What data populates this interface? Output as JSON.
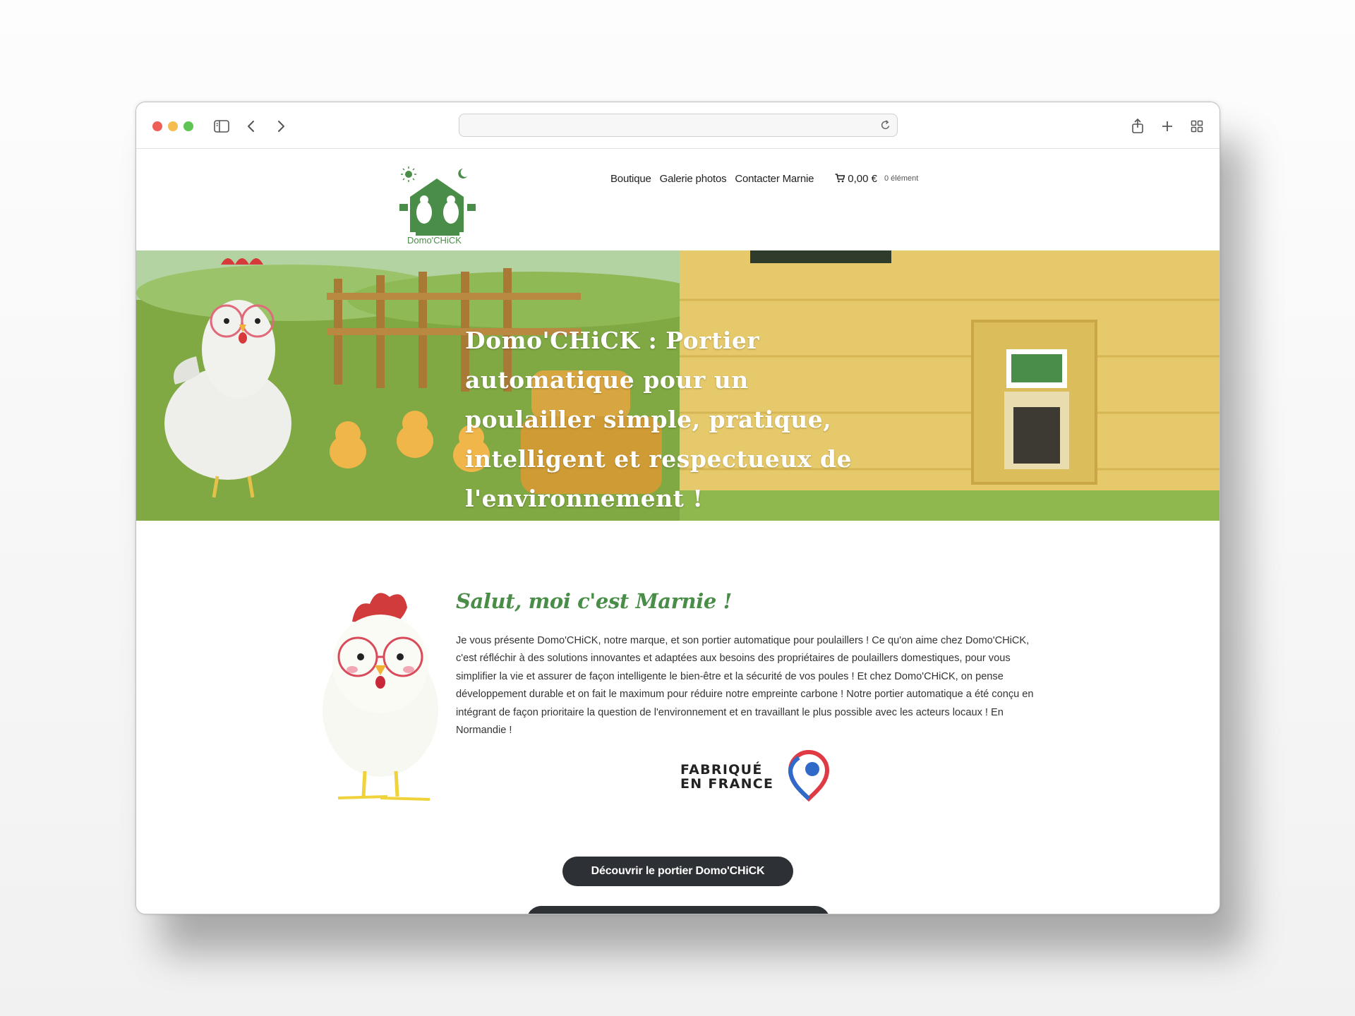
{
  "browser": {
    "url": "",
    "toolbar_icons": [
      "sidebar-icon",
      "back-icon",
      "forward-icon",
      "reload-icon",
      "share-icon",
      "new-tab-icon",
      "tab-overview-icon"
    ]
  },
  "header": {
    "logo_text": "Domo'CHiCK",
    "nav": [
      {
        "label": "Boutique"
      },
      {
        "label": "Galerie photos"
      },
      {
        "label": "Contacter Marnie"
      }
    ],
    "cart": {
      "icon": "cart-icon",
      "amount": "0,00 €",
      "count": "0 élément"
    }
  },
  "hero": {
    "title": "Domo'CHiCK : Portier automatique pour un poulailler simple, pratique, intelligent et respectueux de l'environnement !",
    "colors": {
      "grass": "#7aa33a",
      "coop": "#e3c766",
      "sky": "#aad3e6"
    }
  },
  "intro": {
    "title": "Salut, moi c'est Marnie !",
    "text": "Je vous présente Domo'CHiCK, notre marque, et son portier automatique pour poulaillers ! Ce qu'on aime chez Domo'CHiCK, c'est réfléchir à des solutions innovantes et adaptées aux besoins des propriétaires de poulaillers domestiques, pour vous simplifier la vie et assurer de façon intelligente le bien-être et la sécurité de vos poules ! Et chez Domo'CHiCK, on pense développement durable et on fait le maximum pour réduire notre empreinte carbone ! Notre portier automatique a été conçu en intégrant de façon prioritaire la question de l'environnement et en travaillant le plus possible avec les acteurs locaux ! En Normandie !",
    "badge": {
      "line1": "FABRIQUÉ",
      "line2": "EN FRANCE"
    }
  },
  "cta": {
    "primary": "Découvrir le portier Domo'CHiCK",
    "secondary": ""
  },
  "colors": {
    "brand_green": "#4a8d48",
    "button_dark": "#2d3034"
  }
}
